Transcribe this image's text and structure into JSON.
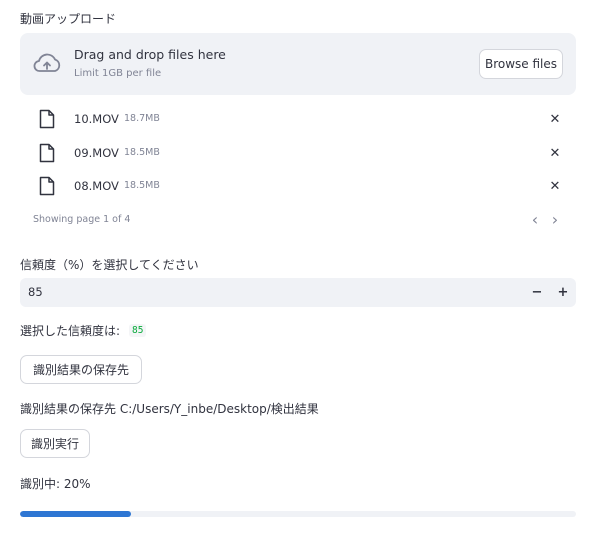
{
  "uploader": {
    "label": "動画アップロード",
    "drop_title": "Drag and drop files here",
    "limit_text": "Limit 1GB per file",
    "browse_label": "Browse files",
    "upload_icon": "cloud-upload-icon",
    "files": [
      {
        "name": "10.MOV",
        "size": "18.7MB"
      },
      {
        "name": "09.MOV",
        "size": "18.5MB"
      },
      {
        "name": "08.MOV",
        "size": "18.5MB"
      }
    ],
    "remove_glyph": "✕",
    "pagination": {
      "text": "Showing page 1 of 4",
      "prev_glyph": "‹",
      "next_glyph": "›"
    }
  },
  "confidence": {
    "label": "信頼度（%）を選択してください",
    "value": "85",
    "decrement": "−",
    "increment": "+"
  },
  "selected": {
    "label": "選択した信頼度は:",
    "value": "85"
  },
  "save_button": {
    "label": "識別結果の保存先"
  },
  "save_path": {
    "text": "識別結果の保存先 C:/Users/Y_inbe/Desktop/検出結果"
  },
  "run_button": {
    "label": "識別実行"
  },
  "status": {
    "text": "識別中: 20%",
    "progress": 0.2
  },
  "colors": {
    "accent": "#2e76d3",
    "dropzone_bg": "#f0f2f6",
    "code_green": "#09ab3b",
    "muted_text": "#808495",
    "text": "#31333f"
  }
}
